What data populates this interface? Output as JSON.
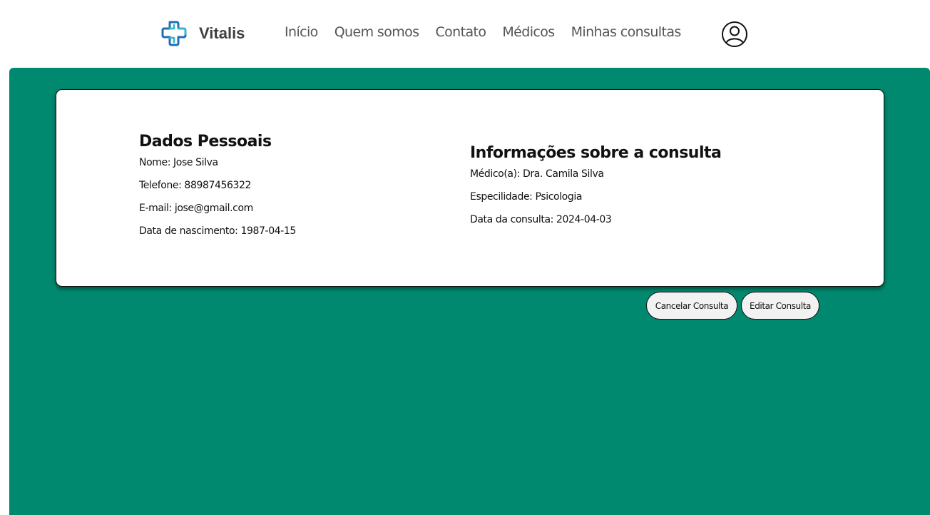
{
  "brand": {
    "name": "Vitalis",
    "logo_icon": "medical-cross-icon",
    "colors": {
      "logo_dark": "#1f6fb5",
      "logo_light": "#35b7c9"
    }
  },
  "nav": {
    "links": [
      {
        "label": "Início"
      },
      {
        "label": "Quem somos"
      },
      {
        "label": "Contato"
      },
      {
        "label": "Médicos"
      },
      {
        "label": "Minhas consultas"
      }
    ],
    "user_icon": "user-profile-icon"
  },
  "colors": {
    "main_background": "#00896f",
    "card_background": "#ffffff",
    "button_background": "#f2f2f2"
  },
  "personal": {
    "title": "Dados Pessoais",
    "lines": [
      "Nome: Jose Silva",
      "Telefone: 88987456322",
      "E-mail: jose@gmail.com",
      "Data de nascimento: 1987-04-15"
    ]
  },
  "consultation": {
    "title": "Informações sobre a consulta",
    "lines": [
      "Médico(a): Dra. Camila Silva",
      "Especilidade: Psicologia",
      "Data da consulta: 2024-04-03"
    ]
  },
  "actions": {
    "cancel_label": "Cancelar Consulta",
    "edit_label": "Editar Consulta"
  }
}
